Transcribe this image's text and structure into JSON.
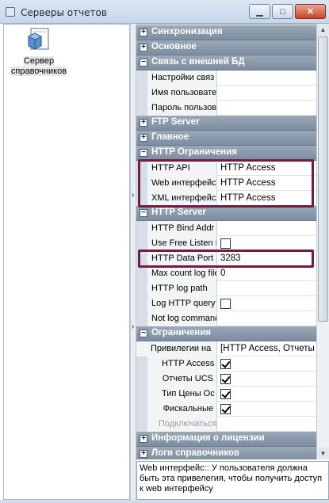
{
  "window": {
    "title": "Серверы отчетов",
    "buttons": {
      "minimize": "▁",
      "maximize": "□",
      "close": "✕"
    }
  },
  "left_pane": {
    "tiles": [
      {
        "label": "Сервер справочников",
        "icon": "server-reference-icon"
      }
    ]
  },
  "splitter": {
    "arrows": [
      "›",
      "›"
    ]
  },
  "property_grid": {
    "rows": [
      {
        "kind": "category",
        "label": "Синхронизация",
        "toggle": "+"
      },
      {
        "kind": "category",
        "label": "Основное",
        "toggle": "+"
      },
      {
        "kind": "category",
        "label": "Связь с внешней БД",
        "toggle": "−"
      },
      {
        "kind": "prop",
        "name": "Настройки связ",
        "value": ""
      },
      {
        "kind": "prop",
        "name": "Имя пользовате",
        "value": ""
      },
      {
        "kind": "prop",
        "name": "Пароль пользов",
        "value": ""
      },
      {
        "kind": "category",
        "label": "FTP Server",
        "toggle": "+"
      },
      {
        "kind": "category",
        "label": "Главное",
        "toggle": "+"
      },
      {
        "kind": "category",
        "label": "HTTP Ограничения",
        "toggle": "−"
      },
      {
        "kind": "prop",
        "name": "HTTP API",
        "value": "HTTP Access"
      },
      {
        "kind": "prop",
        "name": "Web интерфейс",
        "value": "HTTP Access"
      },
      {
        "kind": "prop",
        "name": "XML интерфейс",
        "value": "HTTP Access"
      },
      {
        "kind": "category",
        "label": "HTTP Server",
        "toggle": "−"
      },
      {
        "kind": "prop",
        "name": "HTTP Bind Addr",
        "value": ""
      },
      {
        "kind": "prop",
        "name": "Use Free Listen P",
        "value": "",
        "checkbox": false
      },
      {
        "kind": "prop",
        "name": "HTTP Data Port",
        "value": "3283"
      },
      {
        "kind": "prop",
        "name": "Max count log file",
        "value": "0"
      },
      {
        "kind": "prop",
        "name": "HTTP log path",
        "value": ""
      },
      {
        "kind": "prop",
        "name": "Log HTTP query",
        "value": "",
        "checkbox": false
      },
      {
        "kind": "prop",
        "name": "Not log command",
        "value": ""
      },
      {
        "kind": "category",
        "label": "Ограничения",
        "toggle": "−"
      },
      {
        "kind": "subcat",
        "name": "Привилегии на",
        "value": "[HTTP Access, Отчеты UCS"
      },
      {
        "kind": "prop",
        "name": "HTTP Access",
        "value": "",
        "checkbox": true,
        "indent": 2
      },
      {
        "kind": "prop",
        "name": "Отчеты UCS",
        "value": "",
        "checkbox": true,
        "indent": 2
      },
      {
        "kind": "prop",
        "name": "Тип Цены Ос",
        "value": "",
        "checkbox": true,
        "indent": 2
      },
      {
        "kind": "prop",
        "name": "Фискальные",
        "value": "",
        "checkbox": true,
        "indent": 2
      },
      {
        "kind": "prop",
        "name": "Подключаться к",
        "value": "",
        "disabled": true,
        "indent": 1
      },
      {
        "kind": "category",
        "label": "Информация о лицензии",
        "toggle": "+"
      },
      {
        "kind": "category",
        "label": "Логи справочников",
        "toggle": "+"
      }
    ]
  },
  "scrollbar": {
    "up": "▲",
    "down": "▼"
  },
  "description": {
    "text": "Web интерфейс:: У пользователя должна быть эта привелегия, чтобы получить доступ к web интерфейсу"
  },
  "colors": {
    "category_bg": "#8a99aa",
    "highlight_border": "#6d1e46"
  }
}
